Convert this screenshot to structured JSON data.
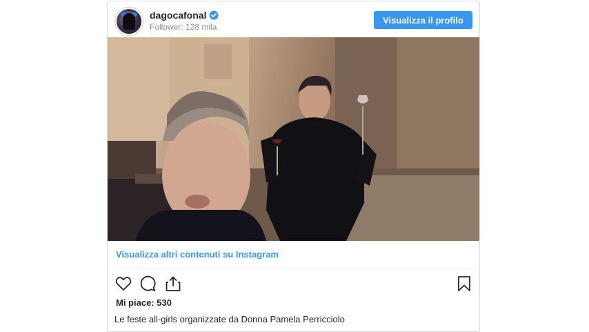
{
  "header": {
    "username": "dagocafonal",
    "followers": "Follower: 128 mila",
    "profile_button": "Visualizza il profilo",
    "verified_icon": "verified-badge-icon",
    "accent_color": "#3897f0"
  },
  "media": {
    "type": "video-frame"
  },
  "more_link": "Visualizza altri contenuti su Instagram",
  "actions": {
    "icons": [
      "heart-icon",
      "comment-icon",
      "share-icon",
      "bookmark-icon"
    ]
  },
  "likes": "Mi piace: 530",
  "caption": "Le feste all-girls organizzate da Donna Pamela Perricciolo"
}
